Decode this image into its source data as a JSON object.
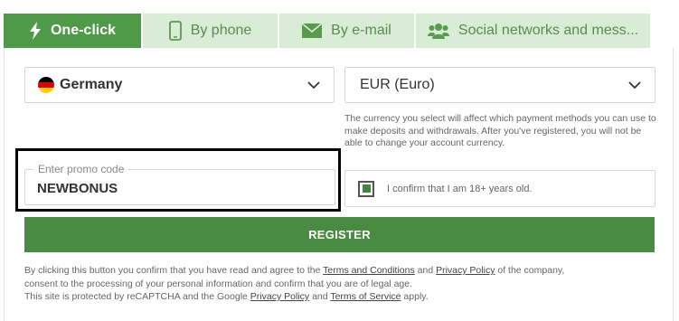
{
  "tabs": [
    {
      "label": "One-click",
      "icon": "lightning-icon",
      "active": true
    },
    {
      "label": "By phone",
      "icon": "phone-icon",
      "active": false
    },
    {
      "label": "By e-mail",
      "icon": "envelope-icon",
      "active": false
    },
    {
      "label": "Social networks and mess...",
      "icon": "users-icon",
      "active": false
    }
  ],
  "form": {
    "country": {
      "value": "Germany",
      "flag": "germany-flag-icon"
    },
    "currency": {
      "value": "EUR (Euro)"
    },
    "currency_note": "The currency you select will affect which payment methods you can use to make deposits and withdrawals. After you've registered, you will not be able to change your account currency.",
    "promo": {
      "label": "Enter promo code",
      "value": "NEWBONUS"
    },
    "age_confirm": {
      "label": "I confirm that I am 18+ years old.",
      "checked": true
    },
    "register_label": "REGISTER"
  },
  "legal": {
    "line1_part1": "By clicking this button you confirm that you have read and agree to the ",
    "terms_link": "Terms and Conditions",
    "and1": " and ",
    "privacy_link": "Privacy Policy",
    "line1_part2": " of the company,",
    "line2": "consent to the processing of your personal information and confirm that you are of legal age.",
    "line3_part1": "This site is protected by reCAPTCHA and the Google ",
    "google_privacy_link": "Privacy Policy",
    "and2": " and ",
    "tos_link": "Terms of Service",
    "line3_part2": " apply."
  },
  "colors": {
    "accent": "#4a8b42",
    "tab_active": "#4f9a48",
    "tab_inactive": "#d9ecd5"
  }
}
